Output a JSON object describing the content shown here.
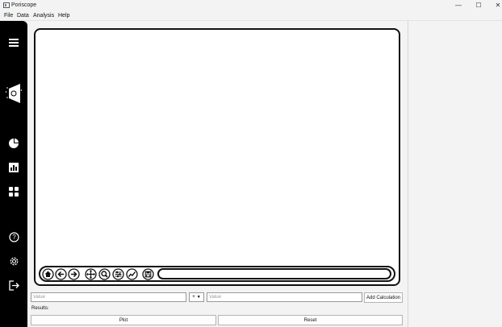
{
  "window": {
    "title": "Poriscope",
    "minimize": "—",
    "maximize": "☐",
    "close": "✕"
  },
  "menu": {
    "items": [
      "File",
      "Data",
      "Analysis",
      "Help"
    ]
  },
  "sidebar": {
    "items": [
      {
        "name": "menu-icon"
      },
      {
        "name": "poriscope-logo-icon"
      },
      {
        "name": "pie-chart-icon"
      },
      {
        "name": "bar-chart-icon"
      },
      {
        "name": "grid-icon"
      },
      {
        "name": "help-icon"
      },
      {
        "name": "settings-icon"
      },
      {
        "name": "logout-icon"
      }
    ]
  },
  "toolbar": {
    "tools": [
      "home-icon",
      "back-icon",
      "forward-icon",
      "pan-icon",
      "zoom-icon",
      "configure-icon",
      "edit-axis-icon",
      "save-icon"
    ]
  },
  "calculator": {
    "value1_placeholder": "Value",
    "operator": "+",
    "operator_arrow": "▼",
    "value2_placeholder": "Value",
    "add_calculation_label": "Add Calculation"
  },
  "results": {
    "label": "Results:"
  },
  "actions": {
    "plot_label": "Plot",
    "reset_label": "Reset"
  }
}
